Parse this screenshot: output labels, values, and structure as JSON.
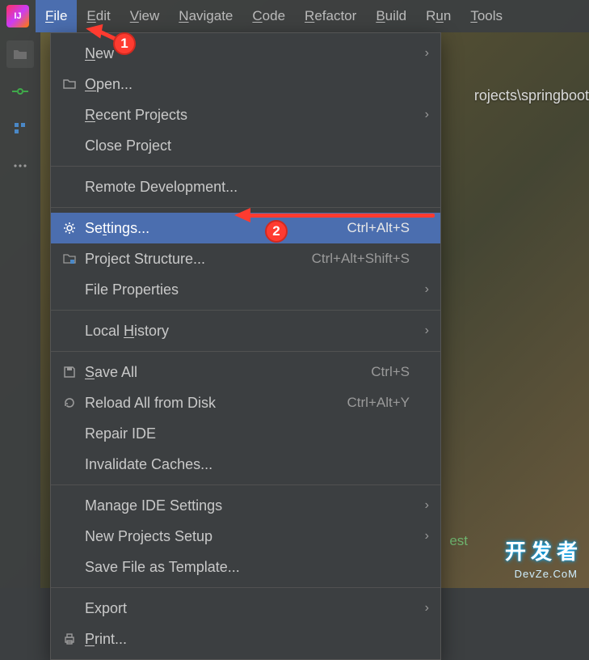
{
  "menu": {
    "items": [
      {
        "pre": "",
        "u": "F",
        "post": "ile",
        "active": true
      },
      {
        "pre": "",
        "u": "E",
        "post": "dit",
        "active": false
      },
      {
        "pre": "",
        "u": "V",
        "post": "iew",
        "active": false
      },
      {
        "pre": "",
        "u": "N",
        "post": "avigate",
        "active": false
      },
      {
        "pre": "",
        "u": "C",
        "post": "ode",
        "active": false
      },
      {
        "pre": "",
        "u": "R",
        "post": "efactor",
        "active": false
      },
      {
        "pre": "",
        "u": "B",
        "post": "uild",
        "active": false
      },
      {
        "pre": "R",
        "u": "u",
        "post": "n",
        "active": false
      },
      {
        "pre": "",
        "u": "T",
        "post": "ools",
        "active": false
      }
    ]
  },
  "dropdown": {
    "groups": [
      [
        {
          "icon": "",
          "pre": "",
          "u": "N",
          "post": "ew",
          "shortcut": "",
          "arrow": true,
          "highlight": false,
          "name": "new"
        },
        {
          "icon": "folder",
          "pre": "",
          "u": "O",
          "post": "pen...",
          "shortcut": "",
          "arrow": false,
          "highlight": false,
          "name": "open"
        },
        {
          "icon": "",
          "pre": "",
          "u": "R",
          "post": "ecent Projects",
          "shortcut": "",
          "arrow": true,
          "highlight": false,
          "name": "recent-projects"
        },
        {
          "icon": "",
          "pre": "Close Pro",
          "u": "j",
          "post": "ect",
          "shortcut": "",
          "arrow": false,
          "highlight": false,
          "name": "close-project"
        }
      ],
      [
        {
          "icon": "",
          "pre": "Remote Development...",
          "u": "",
          "post": "",
          "shortcut": "",
          "arrow": false,
          "highlight": false,
          "name": "remote-dev"
        }
      ],
      [
        {
          "icon": "gear",
          "pre": "Se",
          "u": "t",
          "post": "tings...",
          "shortcut": "Ctrl+Alt+S",
          "arrow": false,
          "highlight": true,
          "name": "settings"
        },
        {
          "icon": "proj-struct",
          "pre": "Project Structure...",
          "u": "",
          "post": "",
          "shortcut": "Ctrl+Alt+Shift+S",
          "arrow": false,
          "highlight": false,
          "name": "project-structure"
        },
        {
          "icon": "",
          "pre": "File Properties",
          "u": "",
          "post": "",
          "shortcut": "",
          "arrow": true,
          "highlight": false,
          "name": "file-properties"
        }
      ],
      [
        {
          "icon": "",
          "pre": "Local ",
          "u": "H",
          "post": "istory",
          "shortcut": "",
          "arrow": true,
          "highlight": false,
          "name": "local-history"
        }
      ],
      [
        {
          "icon": "save",
          "pre": "",
          "u": "S",
          "post": "ave All",
          "shortcut": "Ctrl+S",
          "arrow": false,
          "highlight": false,
          "name": "save-all"
        },
        {
          "icon": "reload",
          "pre": "Reload All from Disk",
          "u": "",
          "post": "",
          "shortcut": "Ctrl+Alt+Y",
          "arrow": false,
          "highlight": false,
          "name": "reload-disk"
        },
        {
          "icon": "",
          "pre": "Repair IDE",
          "u": "",
          "post": "",
          "shortcut": "",
          "arrow": false,
          "highlight": false,
          "name": "repair-ide"
        },
        {
          "icon": "",
          "pre": "Invalidate Caches...",
          "u": "",
          "post": "",
          "shortcut": "",
          "arrow": false,
          "highlight": false,
          "name": "invalidate-caches"
        }
      ],
      [
        {
          "icon": "",
          "pre": "Manage IDE Settings",
          "u": "",
          "post": "",
          "shortcut": "",
          "arrow": true,
          "highlight": false,
          "name": "manage-ide-settings"
        },
        {
          "icon": "",
          "pre": "New Projects Setup",
          "u": "",
          "post": "",
          "shortcut": "",
          "arrow": true,
          "highlight": false,
          "name": "new-projects-setup"
        },
        {
          "icon": "",
          "pre": "Save File as Template...",
          "u": "",
          "post": "",
          "shortcut": "",
          "arrow": false,
          "highlight": false,
          "name": "save-as-template"
        }
      ],
      [
        {
          "icon": "",
          "pre": "Export",
          "u": "",
          "post": "",
          "shortcut": "",
          "arrow": true,
          "highlight": false,
          "name": "export"
        },
        {
          "icon": "print",
          "pre": "",
          "u": "P",
          "post": "rint...",
          "shortcut": "",
          "arrow": false,
          "highlight": false,
          "name": "print"
        }
      ]
    ]
  },
  "path": "rojects\\springboot",
  "green_hint": "est",
  "watermark": {
    "main": "开发者",
    "sub": "DevZe.CoM"
  },
  "annotations": {
    "badge1": "1",
    "badge2": "2"
  },
  "logo_text": "IJ"
}
